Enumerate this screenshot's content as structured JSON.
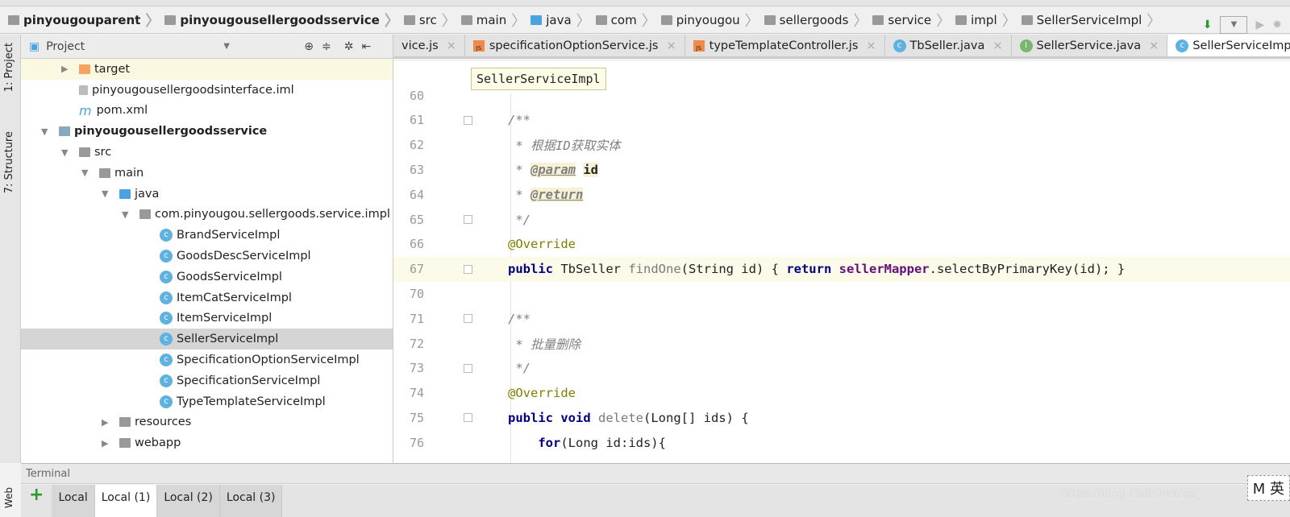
{
  "breadcrumb": [
    {
      "label": "pinyougouparent",
      "icon": "module-folder-icon",
      "bold": true
    },
    {
      "label": "pinyougousellergoodsservice",
      "icon": "module-folder-icon",
      "bold": true
    },
    {
      "label": "src",
      "icon": "folder-icon"
    },
    {
      "label": "main",
      "icon": "folder-icon"
    },
    {
      "label": "java",
      "icon": "source-folder-icon"
    },
    {
      "label": "com",
      "icon": "package-icon"
    },
    {
      "label": "pinyougou",
      "icon": "package-icon"
    },
    {
      "label": "sellergoods",
      "icon": "package-icon"
    },
    {
      "label": "service",
      "icon": "package-icon"
    },
    {
      "label": "impl",
      "icon": "package-icon"
    },
    {
      "label": "SellerServiceImpl",
      "icon": "class-icon"
    }
  ],
  "sidebar": {
    "project_label": "1: Project",
    "structure_label": "7: Structure",
    "web_label": "Web"
  },
  "project": {
    "title": "Project",
    "tree": [
      {
        "label": "target",
        "depth": 2,
        "arrow": "▶",
        "icon": "orange",
        "hl": true
      },
      {
        "label": "pinyougousellergoodsinterface.iml",
        "depth": 2,
        "icon": "file"
      },
      {
        "label": "pom.xml",
        "depth": 2,
        "icon": "m"
      },
      {
        "label": "pinyougousellergoodsservice",
        "depth": 1,
        "arrow": "▼",
        "icon": "module",
        "bold": true
      },
      {
        "label": "src",
        "depth": 2,
        "arrow": "▼",
        "icon": "folder"
      },
      {
        "label": "main",
        "depth": 3,
        "arrow": "▼",
        "icon": "folder"
      },
      {
        "label": "java",
        "depth": 4,
        "arrow": "▼",
        "icon": "blue"
      },
      {
        "label": "com.pinyougou.sellergoods.service.impl",
        "depth": 5,
        "arrow": "▼",
        "icon": "package"
      },
      {
        "label": "BrandServiceImpl",
        "depth": 6,
        "icon": "class"
      },
      {
        "label": "GoodsDescServiceImpl",
        "depth": 6,
        "icon": "class"
      },
      {
        "label": "GoodsServiceImpl",
        "depth": 6,
        "icon": "class"
      },
      {
        "label": "ItemCatServiceImpl",
        "depth": 6,
        "icon": "class"
      },
      {
        "label": "ItemServiceImpl",
        "depth": 6,
        "icon": "class"
      },
      {
        "label": "SellerServiceImpl",
        "depth": 6,
        "icon": "class",
        "sel": true
      },
      {
        "label": "SpecificationOptionServiceImpl",
        "depth": 6,
        "icon": "class"
      },
      {
        "label": "SpecificationServiceImpl",
        "depth": 6,
        "icon": "class"
      },
      {
        "label": "TypeTemplateServiceImpl",
        "depth": 6,
        "icon": "class"
      },
      {
        "label": "resources",
        "depth": 4,
        "arrow": "▶",
        "icon": "folder"
      },
      {
        "label": "webapp",
        "depth": 4,
        "arrow": "▶",
        "icon": "folder"
      }
    ]
  },
  "tabs": [
    {
      "label": "vice.js",
      "icon": "none"
    },
    {
      "label": "specificationOptionService.js",
      "icon": "js"
    },
    {
      "label": "typeTemplateController.js",
      "icon": "js"
    },
    {
      "label": "TbSeller.java",
      "icon": "class"
    },
    {
      "label": "SellerService.java",
      "icon": "interface"
    },
    {
      "label": "SellerServiceImpl.ja",
      "icon": "class",
      "active": true
    }
  ],
  "editor": {
    "tooltip": "SellerServiceImpl",
    "lines": [
      {
        "n": "60",
        "html": ""
      },
      {
        "n": "61",
        "html": "<span class='cm'>/**</span>",
        "fold": true
      },
      {
        "n": "62",
        "html": "<span class='cm'> * 根据ID获取实体</span>"
      },
      {
        "n": "63",
        "html": "<span class='cm'> * </span><span class='tag'>@param</span> <b style='background:#f7f2d6'>id</b>"
      },
      {
        "n": "64",
        "html": "<span class='cm'> * </span><span class='tag'>@return</span>"
      },
      {
        "n": "65",
        "html": "<span class='cm'> */</span>",
        "fold": true
      },
      {
        "n": "66",
        "html": "<span class='ann'>@Override</span>"
      },
      {
        "n": "67",
        "html": "<span class='kw'>public</span> TbSeller <span class='fn'>findOne</span>(String id) { <span class='kw'>return</span> <span class='fld'>sellerMapper</span>.selectByPrimaryKey(id); }",
        "cur": true,
        "fold": true
      },
      {
        "n": "70",
        "html": ""
      },
      {
        "n": "71",
        "html": "<span class='cm'>/**</span>",
        "fold": true
      },
      {
        "n": "72",
        "html": "<span class='cm'> * 批量删除</span>"
      },
      {
        "n": "73",
        "html": "<span class='cm'> */</span>",
        "fold": true
      },
      {
        "n": "74",
        "html": "<span class='ann'>@Override</span>"
      },
      {
        "n": "75",
        "html": "<span class='kw'>public void</span> <span class='fn'>delete</span>(Long[] ids) {",
        "fold": true
      },
      {
        "n": "76",
        "html": "    <span class='kw'>for</span>(Long id:ids){"
      }
    ]
  },
  "terminal": {
    "title": "Terminal",
    "tabs": [
      {
        "label": "Local"
      },
      {
        "label": "Local (1)",
        "active": true
      },
      {
        "label": "Local (2)"
      },
      {
        "label": "Local (3)"
      }
    ]
  },
  "watermark": "https://blog.csdn.net/qq_",
  "ime": "M 英"
}
